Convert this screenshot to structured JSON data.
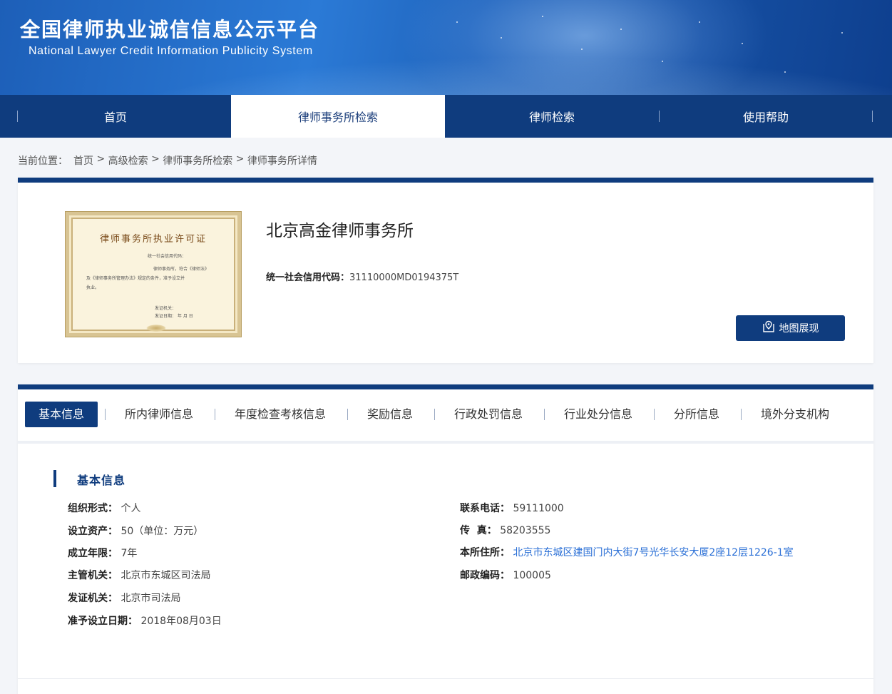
{
  "header": {
    "title": "全国律师执业诚信信息公示平台",
    "subtitle": "National Lawyer Credit Information Publicity System"
  },
  "nav": {
    "items": [
      {
        "label": "首页"
      },
      {
        "label": "律师事务所检索"
      },
      {
        "label": "律师检索"
      },
      {
        "label": "使用帮助"
      }
    ]
  },
  "breadcrumb": {
    "prefix": "当前位置：",
    "items": [
      "首页",
      "高级检索",
      "律师事务所检索",
      "律师事务所详情"
    ],
    "separator": " > "
  },
  "firm": {
    "name": "北京高金律师事务所",
    "credit_label": "统一社会信用代码：",
    "credit_code": "31110000MD0194375T",
    "map_button": "地图展现"
  },
  "certificate": {
    "title": "律师事务所执业许可证",
    "line1": "统一社会信用代码：",
    "line2": "律师事务所，符合《律师法》",
    "line3": "及《律师事务所管理办法》规定的条件，准予设立并",
    "line4": "执业。",
    "line5": "发证机关：",
    "line6": "发证日期：          年     月     日"
  },
  "tabs": [
    {
      "label": "基本信息"
    },
    {
      "label": "所内律师信息"
    },
    {
      "label": "年度检查考核信息"
    },
    {
      "label": "奖励信息"
    },
    {
      "label": "行政处罚信息"
    },
    {
      "label": "行业处分信息"
    },
    {
      "label": "分所信息"
    },
    {
      "label": "境外分支机构"
    }
  ],
  "basic": {
    "section_title": "基本信息",
    "left": [
      {
        "label": "组织形式：",
        "value": "个人"
      },
      {
        "label": "设立资产：",
        "value": "50（单位：万元）"
      },
      {
        "label": "成立年限：",
        "value": "7年"
      },
      {
        "label": "主管机关：",
        "value": "北京市东城区司法局"
      },
      {
        "label": "发证机关：",
        "value": "北京市司法局"
      },
      {
        "label": "准予设立日期：",
        "value": "2018年08月03日"
      }
    ],
    "right": [
      {
        "label": "联系电话：",
        "value": "59111000"
      },
      {
        "label": "传  真：",
        "value": "58203555"
      },
      {
        "label": "本所住所：",
        "value": "北京市东城区建国门内大街7号光华长安大厦2座12层1226-1室"
      },
      {
        "label": "邮政编码：",
        "value": "100005"
      }
    ]
  },
  "colors": {
    "primary": "#0f3c7e",
    "link": "#2a6fd6",
    "background": "#f3f5f9"
  }
}
